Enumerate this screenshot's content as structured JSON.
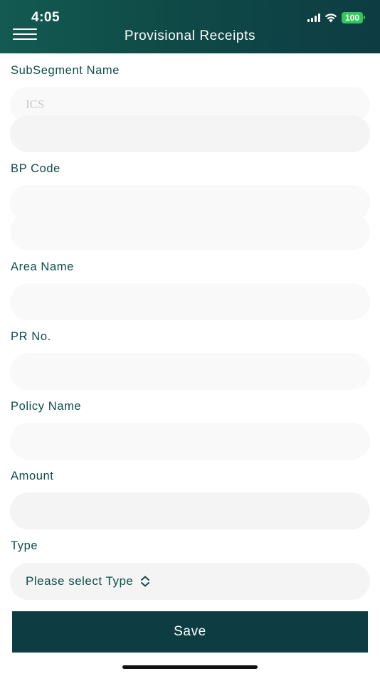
{
  "status_bar": {
    "time": "4:05",
    "battery": "100"
  },
  "header": {
    "title": "Provisional Receipts"
  },
  "form": {
    "subsegment": {
      "label": "SubSegment Name",
      "value": "ICS"
    },
    "bp_code": {
      "label": "BP Code"
    },
    "area_name": {
      "label": "Area Name"
    },
    "pr_no": {
      "label": "PR No."
    },
    "policy_name": {
      "label": "Policy Name"
    },
    "amount": {
      "label": "Amount"
    },
    "type": {
      "label": "Type",
      "selected": "Please select Type"
    }
  },
  "save_label": "Save",
  "colors": {
    "header_dark": "#0d3c43",
    "header_green": "#135a52",
    "label": "#0d4d4a",
    "field_bg": "#f4f4f4"
  }
}
